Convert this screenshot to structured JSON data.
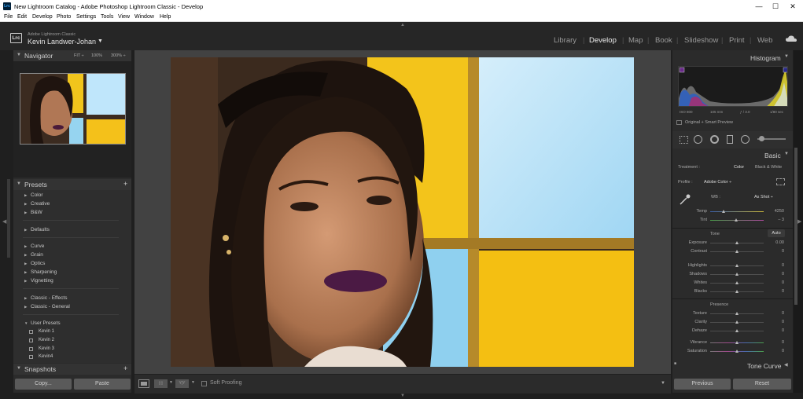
{
  "window": {
    "title": "New Lightroom Catalog - Adobe Photoshop Lightroom Classic - Develop",
    "app_icon": "Lrc",
    "controls": [
      "—",
      "☐",
      "✕"
    ]
  },
  "menu": [
    "File",
    "Edit",
    "Develop",
    "Photo",
    "Settings",
    "Tools",
    "View",
    "Window",
    "Help"
  ],
  "identity": {
    "logo": "Lrc",
    "app_name": "Adobe Lightroom Classic",
    "user": "Kevin Landwer-Johan",
    "arrow": "▼"
  },
  "modules": [
    {
      "label": "Library"
    },
    {
      "label": "Develop",
      "active": true
    },
    {
      "label": "Map"
    },
    {
      "label": "Book"
    },
    {
      "label": "Slideshow"
    },
    {
      "label": "Print"
    },
    {
      "label": "Web"
    }
  ],
  "navigator": {
    "title": "Navigator",
    "zoom": [
      "FIT ÷",
      "100%",
      "300% ÷"
    ]
  },
  "presets": {
    "title": "Presets",
    "add": "+",
    "groups": [
      [
        "Color",
        "Creative",
        "B&W"
      ],
      [
        "Defaults"
      ],
      [
        "Curve",
        "Grain",
        "Optics",
        "Sharpening",
        "Vignetting"
      ],
      [
        "Classic - Effects",
        "Classic - General"
      ],
      [
        "User Presets"
      ]
    ],
    "user_items": [
      "Kevin 1",
      "Kevin 2",
      "Kevin 3",
      "Kevin4"
    ]
  },
  "snapshots": {
    "title": "Snapshots",
    "add": "+"
  },
  "left_buttons": {
    "copy": "Copy...",
    "paste": "Paste"
  },
  "toolbar": {
    "soft_proofing": "Soft Proofing",
    "before_after": "Y|Y"
  },
  "histogram": {
    "title": "Histogram",
    "iso": "ISO 800",
    "focal": "105 mm",
    "aperture": "ƒ / 3.0",
    "shutter": "1/80 sec",
    "preview": "Original + Smart Preview"
  },
  "basic": {
    "title": "Basic",
    "treatment_label": "Treatment :",
    "treatment_color": "Color",
    "treatment_bw": "Black & White",
    "profile_label": "Profile :",
    "profile_value": "Adobe Color ÷",
    "wb_label": "WB :",
    "wb_value": "As Shot ÷",
    "temp": {
      "label": "Temp",
      "value": "4250",
      "pos": 0.25
    },
    "tint": {
      "label": "Tint",
      "value": "– 3",
      "pos": 0.48
    },
    "tone_title": "Tone",
    "auto": "Auto",
    "tone": [
      {
        "label": "Exposure",
        "value": "0.00"
      },
      {
        "label": "Contrast",
        "value": "0"
      },
      {
        "label": "Highlights",
        "value": "0"
      },
      {
        "label": "Shadows",
        "value": "0"
      },
      {
        "label": "Whites",
        "value": "0"
      },
      {
        "label": "Blacks",
        "value": "0"
      }
    ],
    "presence_title": "Presence",
    "presence": [
      {
        "label": "Texture",
        "value": "0"
      },
      {
        "label": "Clarity",
        "value": "0"
      },
      {
        "label": "Dehaze",
        "value": "0"
      },
      {
        "label": "Vibrance",
        "value": "0"
      },
      {
        "label": "Saturation",
        "value": "0"
      }
    ]
  },
  "tone_curve": {
    "title": "Tone Curve"
  },
  "right_buttons": {
    "previous": "Previous",
    "reset": "Reset"
  }
}
